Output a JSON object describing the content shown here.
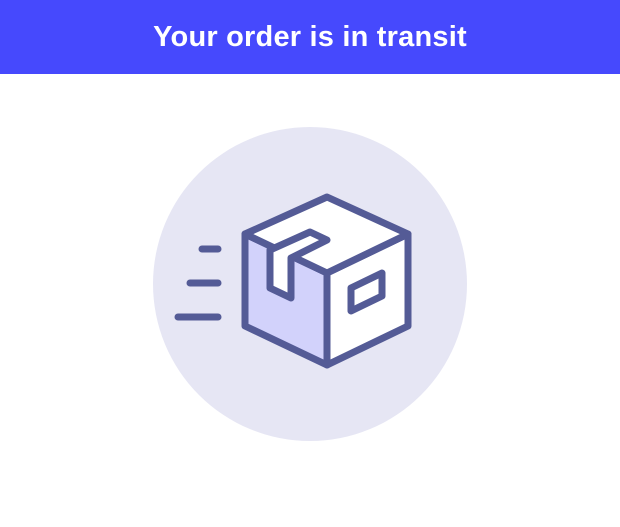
{
  "header": {
    "title": "Your order is in transit"
  },
  "illustration": {
    "icon": "package-in-transit-icon"
  },
  "colors": {
    "header_bg": "#4649FD",
    "header_text": "#FFFFFF",
    "circle_bg": "#E6E6F4",
    "icon_stroke": "#545B96",
    "box_left_fill": "#D2D2FB",
    "box_face_fill": "#FFFFFF"
  }
}
